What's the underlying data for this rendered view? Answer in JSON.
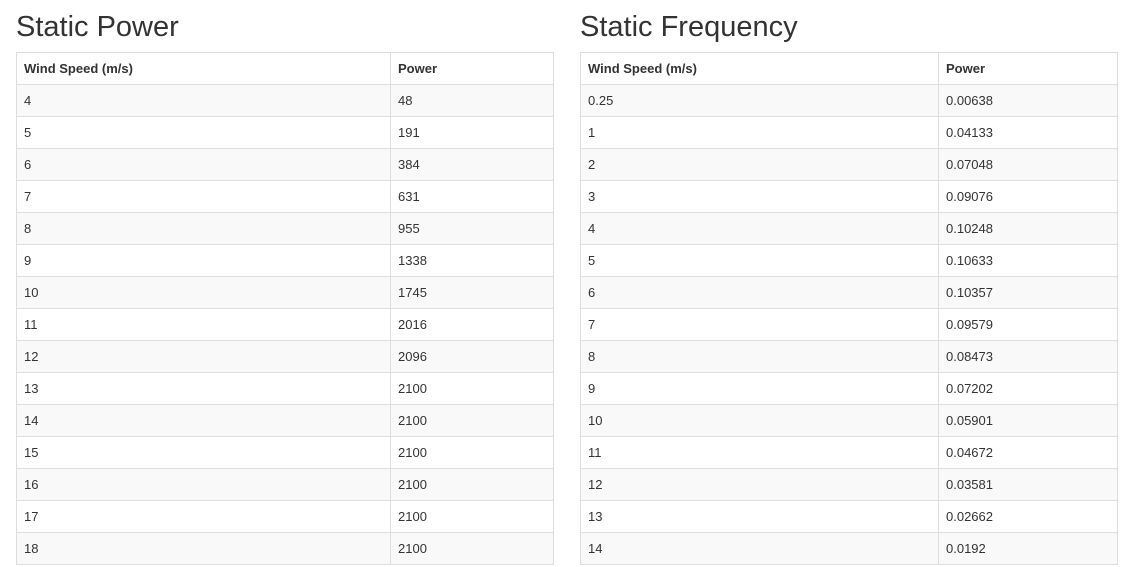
{
  "static_power": {
    "title": "Static Power",
    "columns": [
      "Wind Speed (m/s)",
      "Power"
    ],
    "rows": [
      [
        "4",
        "48"
      ],
      [
        "5",
        "191"
      ],
      [
        "6",
        "384"
      ],
      [
        "7",
        "631"
      ],
      [
        "8",
        "955"
      ],
      [
        "9",
        "1338"
      ],
      [
        "10",
        "1745"
      ],
      [
        "11",
        "2016"
      ],
      [
        "12",
        "2096"
      ],
      [
        "13",
        "2100"
      ],
      [
        "14",
        "2100"
      ],
      [
        "15",
        "2100"
      ],
      [
        "16",
        "2100"
      ],
      [
        "17",
        "2100"
      ],
      [
        "18",
        "2100"
      ]
    ]
  },
  "static_frequency": {
    "title": "Static Frequency",
    "columns": [
      "Wind Speed (m/s)",
      "Power"
    ],
    "rows": [
      [
        "0.25",
        "0.00638"
      ],
      [
        "1",
        "0.04133"
      ],
      [
        "2",
        "0.07048"
      ],
      [
        "3",
        "0.09076"
      ],
      [
        "4",
        "0.10248"
      ],
      [
        "5",
        "0.10633"
      ],
      [
        "6",
        "0.10357"
      ],
      [
        "7",
        "0.09579"
      ],
      [
        "8",
        "0.08473"
      ],
      [
        "9",
        "0.07202"
      ],
      [
        "10",
        "0.05901"
      ],
      [
        "11",
        "0.04672"
      ],
      [
        "12",
        "0.03581"
      ],
      [
        "13",
        "0.02662"
      ],
      [
        "14",
        "0.0192"
      ]
    ]
  }
}
